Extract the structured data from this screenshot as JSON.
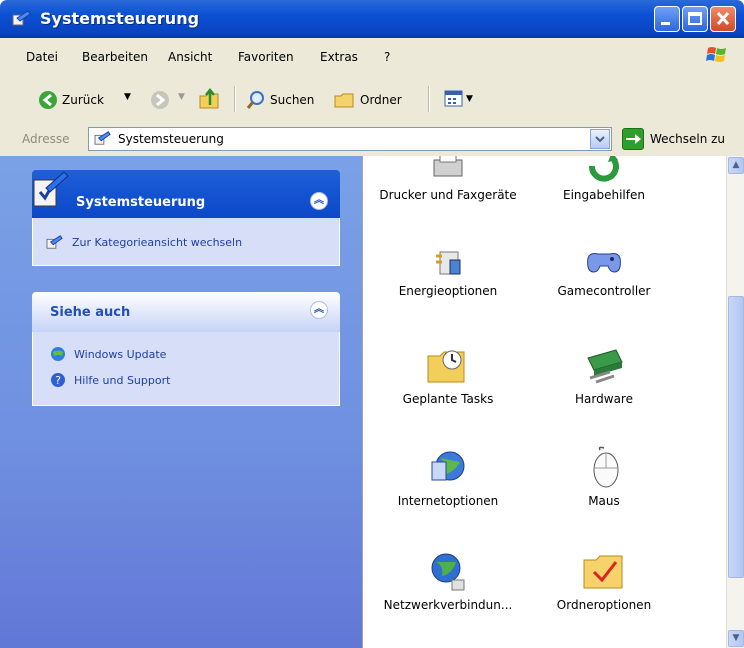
{
  "window": {
    "title": "Systemsteuerung"
  },
  "menu": {
    "items": [
      "Datei",
      "Bearbeiten",
      "Ansicht",
      "Favoriten",
      "Extras",
      "?"
    ]
  },
  "toolbar": {
    "back": "Zurück",
    "search": "Suchen",
    "folders": "Ordner"
  },
  "address": {
    "label": "Adresse",
    "value": "Systemsteuerung",
    "go": "Wechseln zu"
  },
  "tasks": {
    "title": "Systemsteuerung",
    "switch_link": "Zur Kategorieansicht wechseln"
  },
  "see_also": {
    "title": "Siehe auch",
    "links": [
      "Windows Update",
      "Hilfe und Support"
    ]
  },
  "items": [
    {
      "label": "Drucker und Faxgeräte",
      "icon": "printer-icon"
    },
    {
      "label": "Eingabehilfen",
      "icon": "accessibility-icon"
    },
    {
      "label": "Energieoptionen",
      "icon": "power-icon"
    },
    {
      "label": "Gamecontroller",
      "icon": "gamepad-icon"
    },
    {
      "label": "Geplante Tasks",
      "icon": "scheduled-tasks-icon"
    },
    {
      "label": "Hardware",
      "icon": "hardware-icon"
    },
    {
      "label": "Internetoptionen",
      "icon": "internet-options-icon"
    },
    {
      "label": "Maus",
      "icon": "mouse-icon"
    },
    {
      "label": "Netzwerkverbindun...",
      "icon": "network-icon"
    },
    {
      "label": "Ordneroptionen",
      "icon": "folder-options-icon"
    }
  ]
}
